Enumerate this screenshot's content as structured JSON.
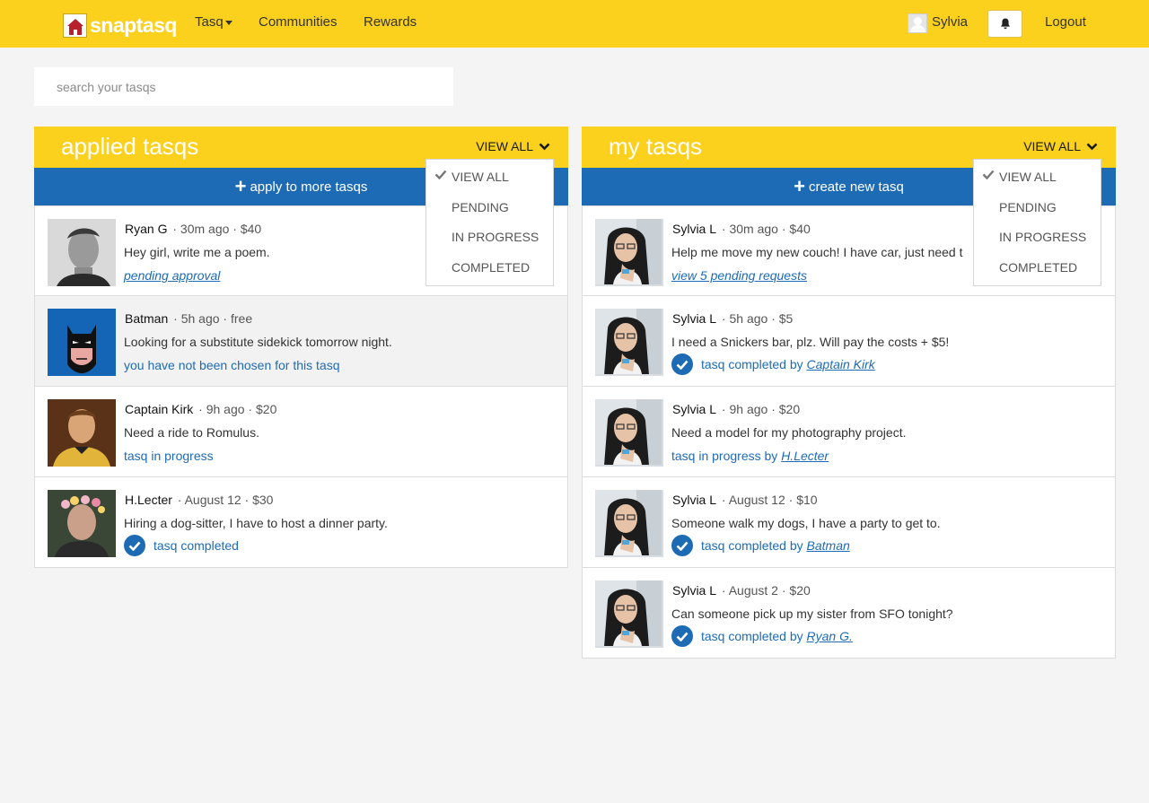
{
  "nav": {
    "logo_text": "snaptasq",
    "menu": [
      "Tasq",
      "Communities",
      "Rewards"
    ],
    "user_name": "Sylvia",
    "logout_label": "Logout",
    "accent_color": "#fbd11e",
    "primary_color": "#1e6bb5"
  },
  "search": {
    "placeholder": "search your tasqs"
  },
  "applied": {
    "title": "applied tasqs",
    "filter_label": "VIEW ALL",
    "action_label": "apply to more tasqs",
    "dropdown": [
      "VIEW ALL",
      "PENDING",
      "IN PROGRESS",
      "COMPLETED"
    ],
    "selected": "VIEW ALL",
    "items": [
      {
        "name": "Ryan G",
        "time": "30m ago",
        "price": "$40",
        "desc": "Hey girl, write me a poem.",
        "status_link": "pending approval"
      },
      {
        "name": "Batman",
        "time": "5h ago",
        "price": "free",
        "desc": "Looking for a substitute sidekick tomorrow night.",
        "status": "you have not been chosen for this tasq"
      },
      {
        "name": "Captain Kirk",
        "time": "9h ago",
        "price": "$20",
        "desc": "Need a ride to Romulus.",
        "status": "tasq in progress"
      },
      {
        "name": "H.Lecter",
        "time": "August 12",
        "price": "$30",
        "desc": "Hiring a dog-sitter, I have to host a dinner party.",
        "status": "tasq completed"
      }
    ]
  },
  "mine": {
    "title": "my tasqs",
    "filter_label": "VIEW ALL",
    "action_label": "create new tasq",
    "dropdown": [
      "VIEW ALL",
      "PENDING",
      "IN PROGRESS",
      "COMPLETED"
    ],
    "selected": "VIEW ALL",
    "items": [
      {
        "name": "Sylvia L",
        "time": "30m ago",
        "price": "$40",
        "desc": "Help me move my new couch! I have car, just need t",
        "status_link": "view 5 pending requests"
      },
      {
        "name": "Sylvia L",
        "time": "5h ago",
        "price": "$5",
        "desc": "I need a Snickers bar, plz. Will pay the costs + $5!",
        "status": "tasq completed by",
        "by": "Captain Kirk"
      },
      {
        "name": "Sylvia L",
        "time": "9h ago",
        "price": "$20",
        "desc": "Need a model for my photography project.",
        "status": "tasq in progress by",
        "by": "H.Lecter"
      },
      {
        "name": "Sylvia L",
        "time": "August 12",
        "price": "$10",
        "desc": "Someone walk my dogs, I have a party to get to.",
        "status": "tasq completed by",
        "by": "Batman"
      },
      {
        "name": "Sylvia L",
        "time": "August 2",
        "price": "$20",
        "desc": "Can someone pick up my sister from SFO tonight?",
        "status": "tasq completed by",
        "by": "Ryan G."
      }
    ]
  }
}
